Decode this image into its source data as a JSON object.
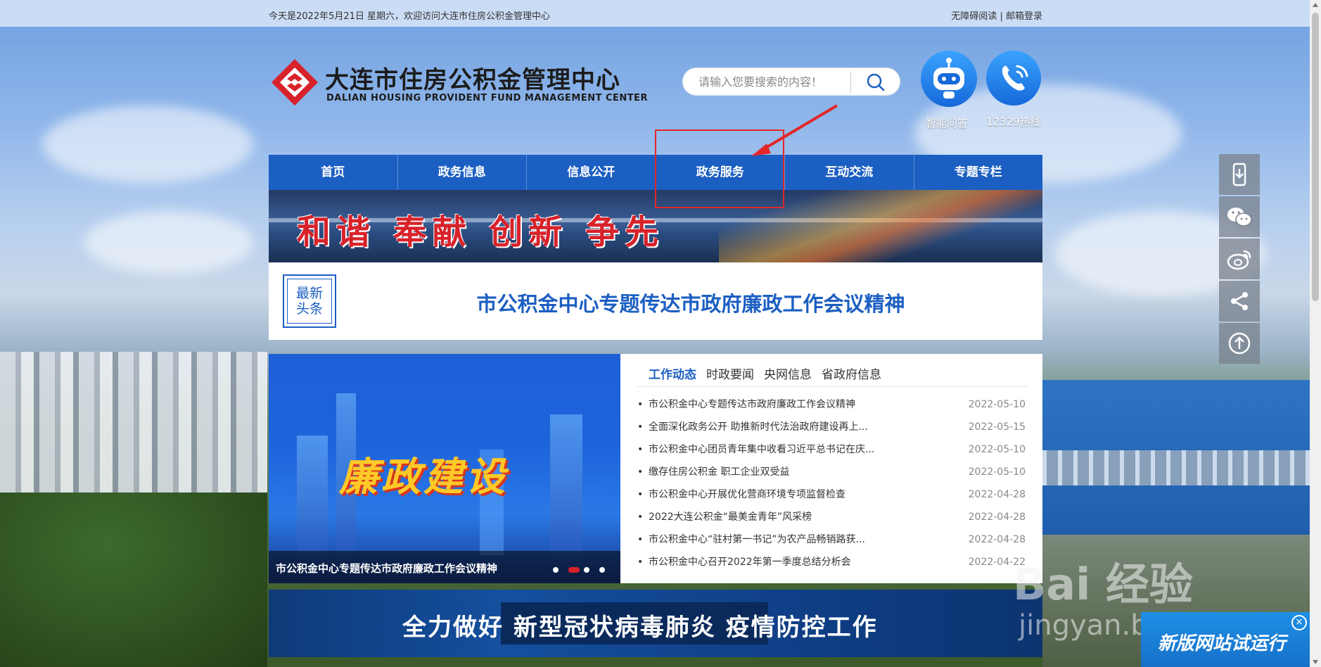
{
  "topbar": {
    "date_text": "今天是2022年5月21日 星期六，欢迎访问大连市住房公积金管理中心",
    "accessibility": "无障碍阅读",
    "divider": "|",
    "mail_login": "邮箱登录"
  },
  "header": {
    "org_name_cn": "大连市住房公积金管理中心",
    "org_name_en": "DALIAN HOUSING PROVIDENT FUND MANAGEMENT CENTER",
    "search_placeholder": "请输入您要搜索的内容！",
    "assistant_label": "智能问答",
    "hotline_label": "12329热线"
  },
  "nav": {
    "items": [
      {
        "label": "首页"
      },
      {
        "label": "政务信息"
      },
      {
        "label": "信息公开"
      },
      {
        "label": "政务服务"
      },
      {
        "label": "互动交流"
      },
      {
        "label": "专题专栏"
      }
    ]
  },
  "banner": {
    "slogan": "和谐 奉献 创新 争先"
  },
  "headline": {
    "tag_line1": "最新",
    "tag_line2": "头条",
    "title": "市公积金中心专题传达市政府廉政工作会议精神"
  },
  "slider": {
    "image_text": "廉政建设",
    "caption": "市公积金中心专题传达市政府廉政工作会议精神",
    "slide_count": 4,
    "active_slide": 2
  },
  "news": {
    "tabs": [
      {
        "label": "工作动态",
        "active": true
      },
      {
        "label": "时政要闻",
        "active": false
      },
      {
        "label": "央网信息",
        "active": false
      },
      {
        "label": "省政府信息",
        "active": false
      }
    ],
    "items": [
      {
        "title": "市公积金中心专题传达市政府廉政工作会议精神",
        "date": "2022-05-10"
      },
      {
        "title": "全面深化政务公开 助推新时代法治政府建设再上...",
        "date": "2022-05-15"
      },
      {
        "title": "市公积金中心团员青年集中收看习近平总书记在庆...",
        "date": "2022-05-10"
      },
      {
        "title": "缴存住房公积金 职工企业双受益",
        "date": "2022-05-10"
      },
      {
        "title": "市公积金中心开展优化营商环境专项监督检查",
        "date": "2022-04-28"
      },
      {
        "title": "2022大连公积金“最美金青年”风采榜",
        "date": "2022-04-28"
      },
      {
        "title": "市公积金中心“驻村第一书记”为农产品畅销路获...",
        "date": "2022-04-28"
      },
      {
        "title": "市公积金中心召开2022年第一季度总结分析会",
        "date": "2022-04-22"
      }
    ]
  },
  "covid_banner": {
    "text": "全力做好 新型冠状病毒肺炎 疫情防控工作"
  },
  "floatbar": {
    "icons": [
      "mobile-download-icon",
      "wechat-icon",
      "weibo-icon",
      "share-icon",
      "back-to-top-icon"
    ]
  },
  "popup": {
    "text": "新版网站试运行",
    "close": "×"
  },
  "watermark": {
    "line1": "Bai 经验",
    "line2": "jingyan.baidu.com"
  },
  "colors": {
    "brand_blue": "#1c5fc2",
    "annotation_red": "#e3262a",
    "brand_red": "#d8222a"
  }
}
